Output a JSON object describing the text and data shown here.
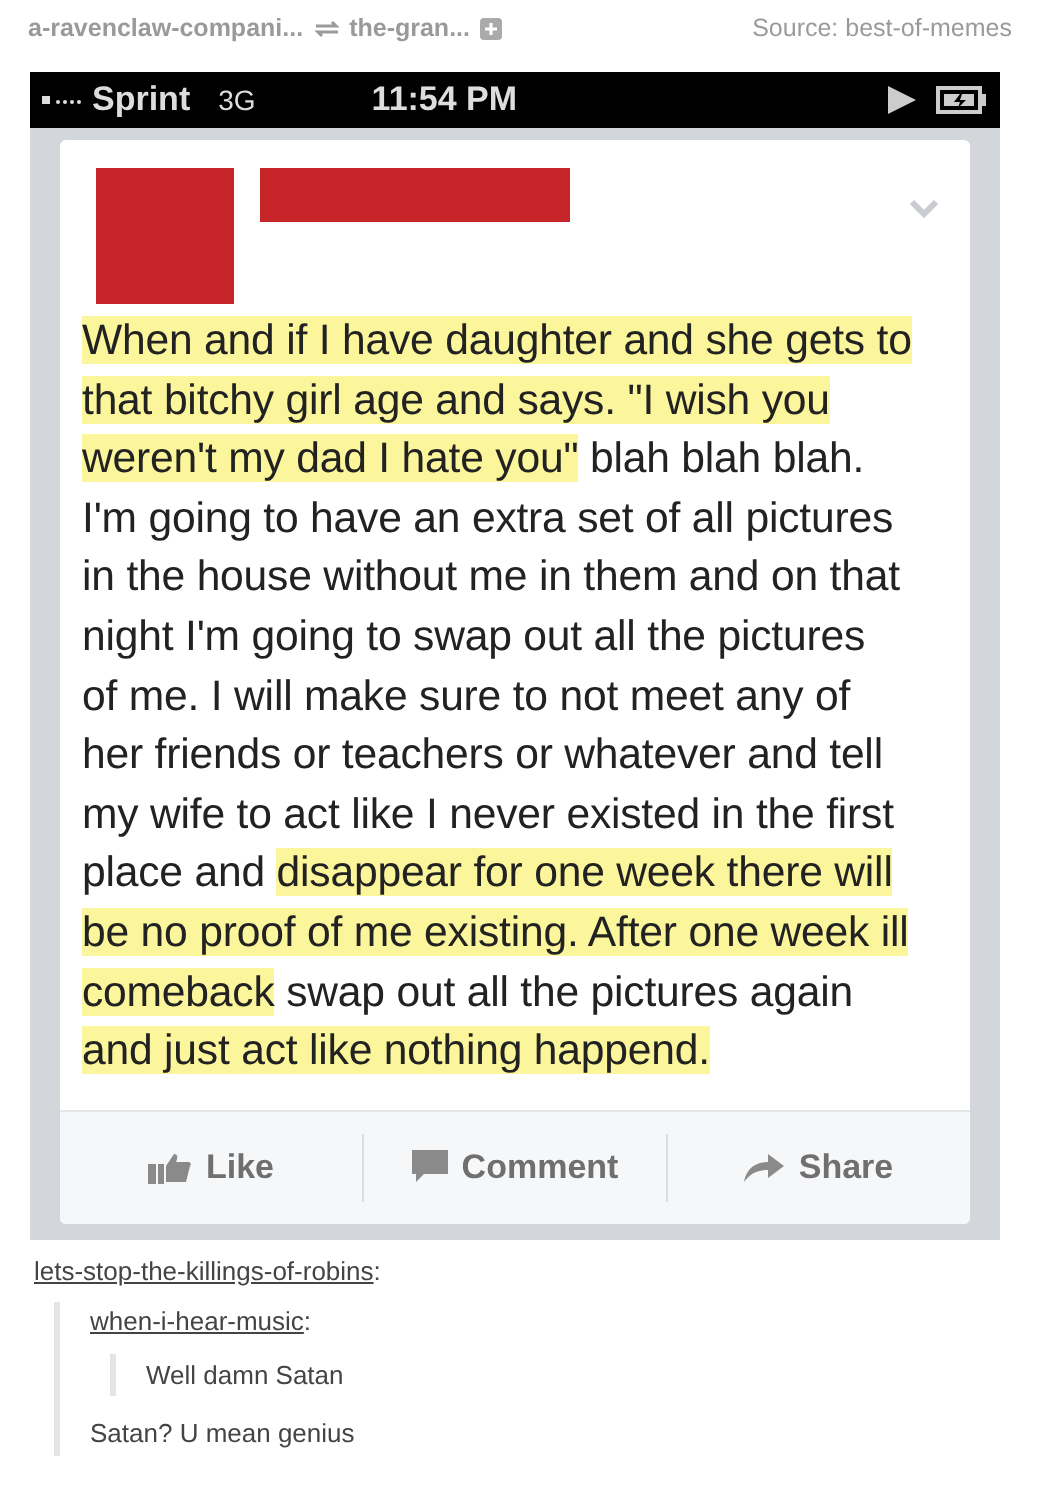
{
  "header": {
    "reblogged_from": "a-ravenclaw-compani...",
    "via": "the-gran...",
    "source": "Source: best-of-memes"
  },
  "status_bar": {
    "carrier": "Sprint",
    "network": "3G",
    "time": "11:54 PM"
  },
  "post": {
    "lines": [
      [
        {
          "text": "When and if I have daughter and she gets to",
          "highlighted": true
        }
      ],
      [
        {
          "text": "that bitchy girl age and says. \"I wish you",
          "highlighted": true
        }
      ],
      [
        {
          "text": "weren't my dad I hate you\"",
          "highlighted": true
        },
        {
          "text": " blah blah blah.",
          "highlighted": false
        }
      ],
      [
        {
          "text": "I'm going to have an extra set of all pictures",
          "highlighted": false
        }
      ],
      [
        {
          "text": "in the house without me in them and on that",
          "highlighted": false
        }
      ],
      [
        {
          "text": "night I'm going to swap out all the pictures",
          "highlighted": false
        }
      ],
      [
        {
          "text": "of me. I will make sure to not meet any of",
          "highlighted": false
        }
      ],
      [
        {
          "text": "her friends or teachers or whatever and tell",
          "highlighted": false
        }
      ],
      [
        {
          "text": "my wife to act like I never existed in the first",
          "highlighted": false
        }
      ],
      [
        {
          "text": "place and ",
          "highlighted": false
        },
        {
          "text": "disappear for one week there will",
          "highlighted": true
        }
      ],
      [
        {
          "text": "be no proof of me existing. After one week ill",
          "highlighted": true
        }
      ],
      [
        {
          "text": "comeback",
          "highlighted": true
        },
        {
          "text": " swap out all the pictures again",
          "highlighted": false
        }
      ],
      [
        {
          "text": "and just act like nothing happend.",
          "highlighted": true
        }
      ]
    ],
    "actions": [
      {
        "label": "Like",
        "kind": "like"
      },
      {
        "label": "Comment",
        "kind": "comment"
      },
      {
        "label": "Share",
        "kind": "share"
      }
    ]
  },
  "thread": {
    "user": "lets-stop-the-killings-of-robins",
    "colon": ":",
    "quote": {
      "user": "when-i-hear-music",
      "colon": ":",
      "quote_text": "Well damn Satan",
      "reply": "Satan? U mean genius"
    }
  }
}
